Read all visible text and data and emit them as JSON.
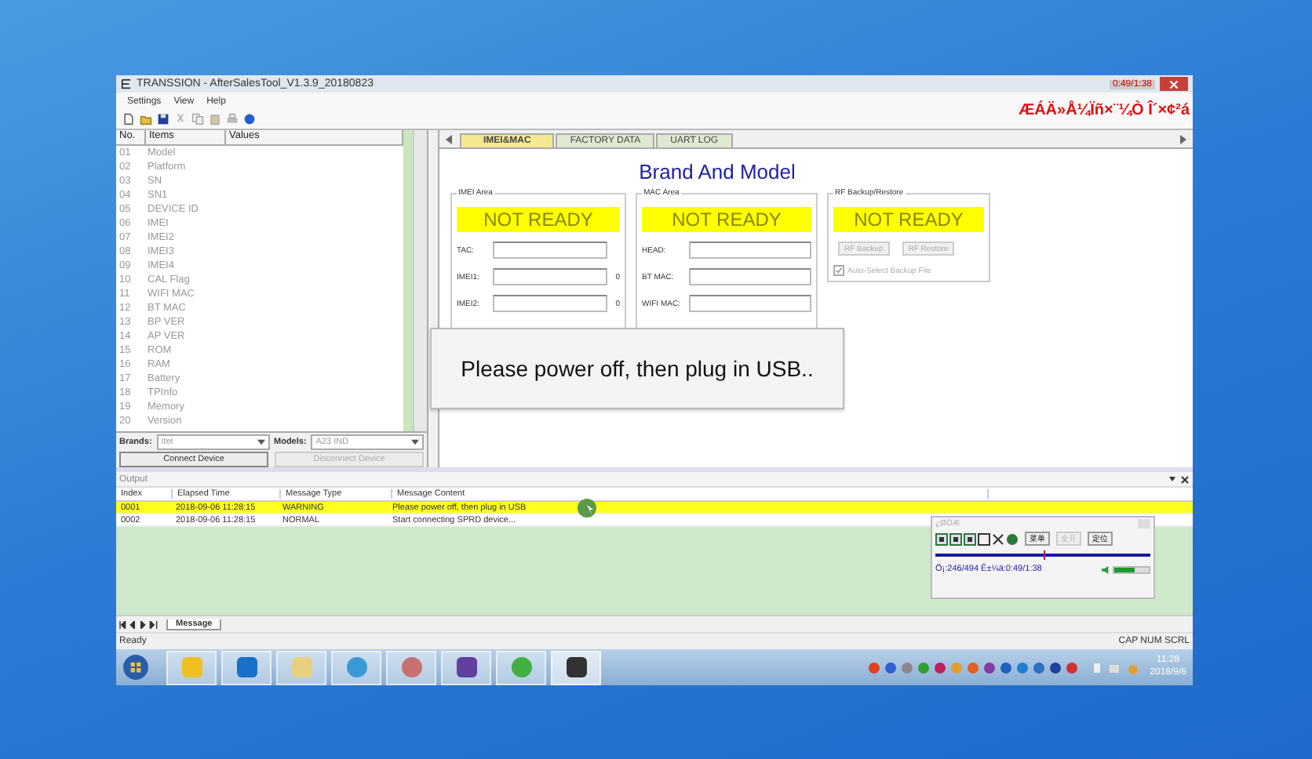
{
  "window": {
    "title": "TRANSSION - AfterSalesTool_V1.3.9_20180823",
    "timer": "0:49/1:38",
    "banner": "ÆÁÄ»Å¼Ïñ×¨¼Ò Î´×¢²á"
  },
  "menu": [
    "Settings",
    "View",
    "Help"
  ],
  "items_table": {
    "columns": [
      "No.",
      "Items",
      "Values"
    ],
    "rows": [
      {
        "no": "01",
        "item": "Model"
      },
      {
        "no": "02",
        "item": "Platform"
      },
      {
        "no": "03",
        "item": "SN"
      },
      {
        "no": "04",
        "item": "SN1"
      },
      {
        "no": "05",
        "item": "DEVICE ID"
      },
      {
        "no": "06",
        "item": "IMEI"
      },
      {
        "no": "07",
        "item": "IMEI2"
      },
      {
        "no": "08",
        "item": "IMEI3"
      },
      {
        "no": "09",
        "item": "IMEI4"
      },
      {
        "no": "10",
        "item": "CAL Flag"
      },
      {
        "no": "11",
        "item": "WIFI MAC"
      },
      {
        "no": "12",
        "item": "BT MAC"
      },
      {
        "no": "13",
        "item": "BP VER"
      },
      {
        "no": "14",
        "item": "AP VER"
      },
      {
        "no": "15",
        "item": "ROM"
      },
      {
        "no": "16",
        "item": "RAM"
      },
      {
        "no": "17",
        "item": "Battery"
      },
      {
        "no": "18",
        "item": "TPInfo"
      },
      {
        "no": "19",
        "item": "Memory"
      },
      {
        "no": "20",
        "item": "Version"
      }
    ]
  },
  "brands": {
    "label": "Brands:",
    "value": "Itel"
  },
  "models": {
    "label": "Models:",
    "value": "A23 IND"
  },
  "device_buttons": [
    {
      "label": "Connect Device",
      "disabled": false
    },
    {
      "label": "Disconnect Device",
      "disabled": true
    }
  ],
  "tabs": [
    {
      "label": "IMEI&MAC",
      "selected": true
    },
    {
      "label": "FACTORY DATA",
      "selected": false
    },
    {
      "label": "UART LOG",
      "selected": false
    }
  ],
  "heading": "Brand And Model",
  "imei_area": {
    "title": "IMEI Area",
    "status": "NOT READY",
    "fields": [
      {
        "label": "TAC:"
      },
      {
        "label": "IMEI1:",
        "suffix": "0"
      },
      {
        "label": "IMEI2:",
        "suffix": "0"
      }
    ]
  },
  "mac_area": {
    "title": "MAC Area",
    "status": "NOT READY",
    "fields": [
      {
        "label": "HEAD:"
      },
      {
        "label": "BT MAC:"
      },
      {
        "label": "WIFI MAC:"
      }
    ]
  },
  "rf_area": {
    "title": "RF Backup/Restore",
    "status": "NOT READY",
    "buttons": [
      {
        "label": "RF Backup",
        "disabled": true
      },
      {
        "label": "RF Restore",
        "disabled": true
      }
    ],
    "checkbox": {
      "label": "Auto-Select Backup File",
      "checked": true,
      "disabled": true
    }
  },
  "popup": {
    "message": "Please power off, then plug in USB.."
  },
  "output": {
    "title": "Output",
    "columns": [
      "Index",
      "Elapsed Time",
      "Message Type",
      "Message Content"
    ],
    "rows": [
      {
        "cells": [
          "0001",
          "2018-09-06 11:28:15",
          "WARNING",
          "Please power off, then plug in USB"
        ],
        "selected": true
      },
      {
        "cells": [
          "0002",
          "2018-09-06 11:28:15",
          "NORMAL",
          "Start connecting SPRD device..."
        ],
        "selected": false
      }
    ]
  },
  "sheet_tab": "Message",
  "status_bar": {
    "text": "Ready",
    "indicators": "CAP NUM SCRL"
  },
  "player": {
    "title": "¿ØÖÆ",
    "buttons": [
      {
        "label": "菜单",
        "disabled": false
      },
      {
        "label": "全开",
        "disabled": true
      },
      {
        "label": "定位",
        "disabled": false
      }
    ],
    "progress": {
      "level": 0.5
    },
    "info": "Ö¡:246/494 Ê±¼ä:0:49/1:38",
    "volume": {
      "level": 0.6
    }
  },
  "clock": {
    "time": "11:28",
    "date": "2018/9/6"
  }
}
